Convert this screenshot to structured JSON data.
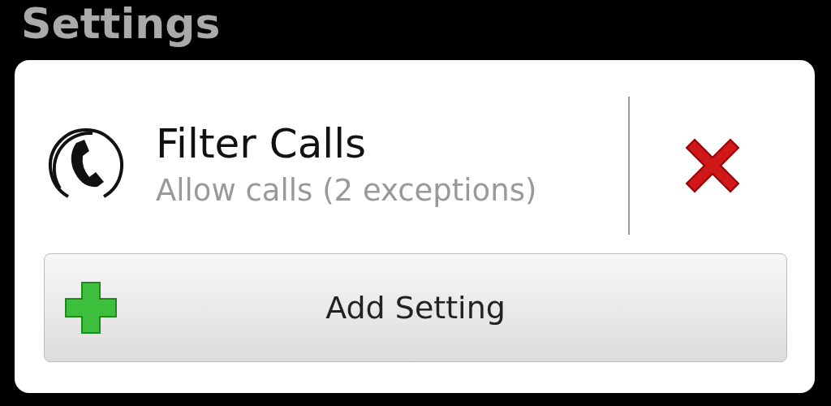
{
  "header": {
    "title": "Settings"
  },
  "settings": [
    {
      "title": "Filter Calls",
      "summary": "Allow calls (2 exceptions)"
    }
  ],
  "add_button": {
    "label": "Add Setting"
  }
}
